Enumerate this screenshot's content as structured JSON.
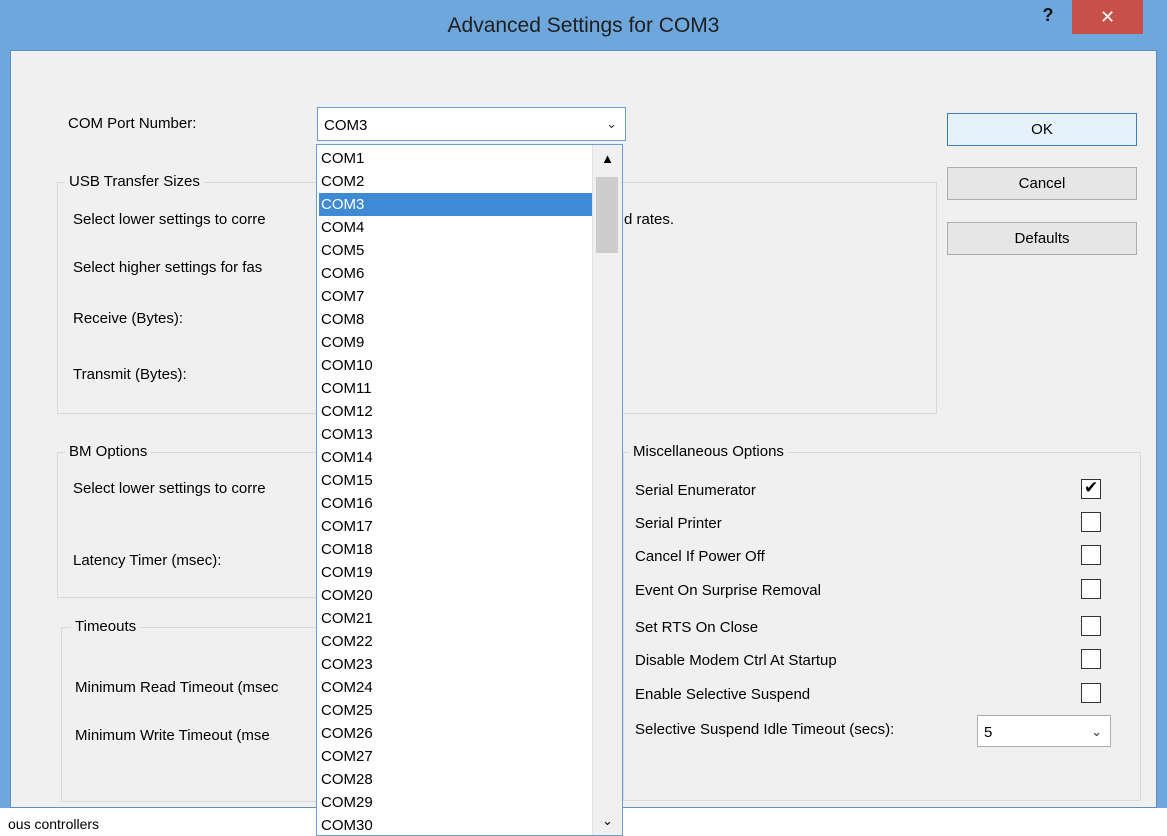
{
  "window": {
    "title": "Advanced Settings for COM3",
    "help_label": "?",
    "close_label": "✕"
  },
  "com_port": {
    "label": "COM Port Number:",
    "value": "COM3"
  },
  "buttons": {
    "ok": "OK",
    "cancel": "Cancel",
    "defaults": "Defaults"
  },
  "usb": {
    "title": "USB Transfer Sizes",
    "desc_low": "Select lower settings to corre",
    "desc_low_tail": "d rates.",
    "desc_high": "Select higher settings for fas",
    "receive": "Receive (Bytes):",
    "transmit": "Transmit (Bytes):"
  },
  "bm": {
    "title": "BM Options",
    "desc": "Select lower settings to corre",
    "latency": "Latency Timer (msec):"
  },
  "timeouts": {
    "title": "Timeouts",
    "read": "Minimum Read Timeout (msec",
    "write": "Minimum Write Timeout (mse"
  },
  "misc": {
    "title": "Miscellaneous Options",
    "items": [
      {
        "label": "Serial Enumerator",
        "checked": true
      },
      {
        "label": "Serial Printer",
        "checked": false
      },
      {
        "label": "Cancel If Power Off",
        "checked": false
      },
      {
        "label": "Event On Surprise Removal",
        "checked": false
      },
      {
        "label": "Set RTS On Close",
        "checked": false
      },
      {
        "label": "Disable Modem Ctrl At Startup",
        "checked": false
      },
      {
        "label": "Enable Selective Suspend",
        "checked": false
      }
    ],
    "suspend_label": "Selective Suspend Idle Timeout (secs):",
    "suspend_value": "5"
  },
  "dropdown": {
    "selected": "COM3",
    "options": [
      "COM1",
      "COM2",
      "COM3",
      "COM4",
      "COM5",
      "COM6",
      "COM7",
      "COM8",
      "COM9",
      "COM10",
      "COM11",
      "COM12",
      "COM13",
      "COM14",
      "COM15",
      "COM16",
      "COM17",
      "COM18",
      "COM19",
      "COM20",
      "COM21",
      "COM22",
      "COM23",
      "COM24",
      "COM25",
      "COM26",
      "COM27",
      "COM28",
      "COM29",
      "COM30"
    ]
  },
  "background": {
    "text": "ous controllers"
  },
  "icons": {
    "chevron_down": "⌄",
    "scroll_up": "▲",
    "scroll_down": "⌄",
    "check": "✔"
  },
  "colors": {
    "title_bar": "#6ea7dc",
    "close_button": "#c7504b",
    "selection": "#3e8ad5"
  }
}
